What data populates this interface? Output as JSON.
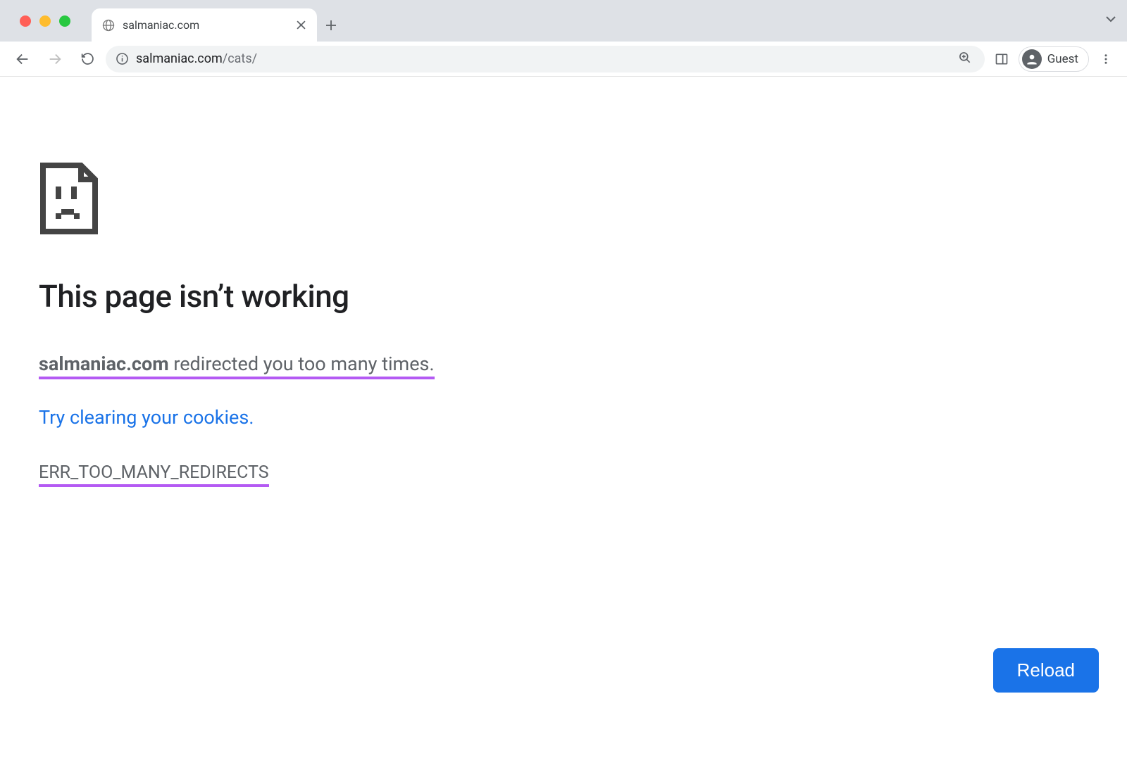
{
  "window": {
    "tab_title": "salmaniac.com",
    "profile_label": "Guest"
  },
  "omnibox": {
    "host": "salmaniac.com",
    "path": "/cats/"
  },
  "error": {
    "heading": "This page isn’t working",
    "host": "salmaniac.com",
    "redirect_msg_suffix": " redirected you too many times. ",
    "suggestion_link": "Try clearing your cookies",
    "suggestion_dot": ".",
    "code": "ERR_TOO_MANY_REDIRECTS",
    "reload_label": "Reload"
  }
}
